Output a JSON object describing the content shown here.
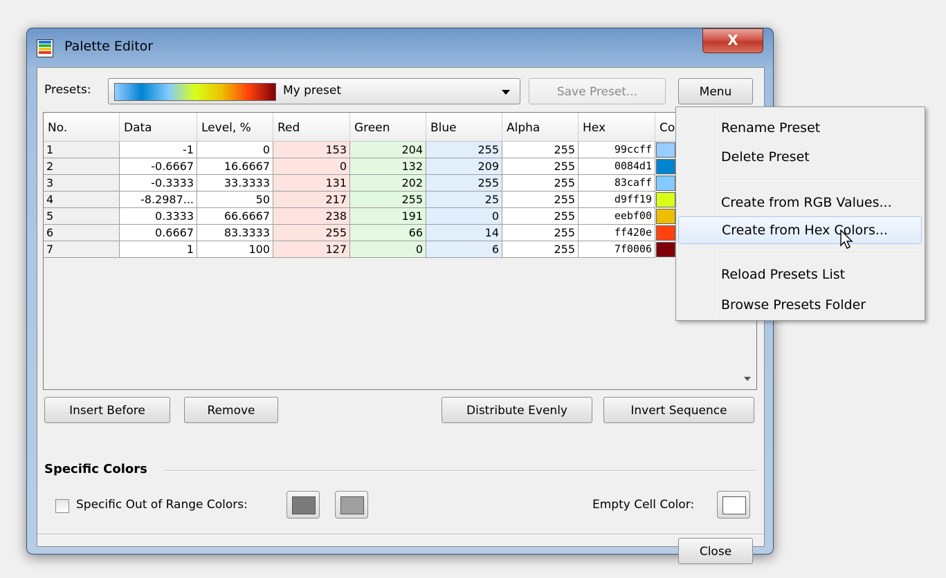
{
  "window": {
    "title": "Palette Editor",
    "close_glyph": "X"
  },
  "presets": {
    "label": "Presets:",
    "selected": "My preset",
    "save_label": "Save Preset...",
    "menu_label": "Menu"
  },
  "table": {
    "columns": [
      "No.",
      "Data",
      "Level, %",
      "Red",
      "Green",
      "Blue",
      "Alpha",
      "Hex",
      "Co"
    ],
    "rows": [
      {
        "no": "1",
        "data": "-1",
        "level": "0",
        "red": "153",
        "green": "204",
        "blue": "255",
        "alpha": "255",
        "hex": "99ccff",
        "color": "#99ccff"
      },
      {
        "no": "2",
        "data": "-0.6667",
        "level": "16.6667",
        "red": "0",
        "green": "132",
        "blue": "209",
        "alpha": "255",
        "hex": "0084d1",
        "color": "#0084d1"
      },
      {
        "no": "3",
        "data": "-0.3333",
        "level": "33.3333",
        "red": "131",
        "green": "202",
        "blue": "255",
        "alpha": "255",
        "hex": "83caff",
        "color": "#83caff"
      },
      {
        "no": "4",
        "data": "-8.2987...",
        "level": "50",
        "red": "217",
        "green": "255",
        "blue": "25",
        "alpha": "255",
        "hex": "d9ff19",
        "color": "#d9ff19"
      },
      {
        "no": "5",
        "data": "0.3333",
        "level": "66.6667",
        "red": "238",
        "green": "191",
        "blue": "0",
        "alpha": "255",
        "hex": "eebf00",
        "color": "#eebf00"
      },
      {
        "no": "6",
        "data": "0.6667",
        "level": "83.3333",
        "red": "255",
        "green": "66",
        "blue": "14",
        "alpha": "255",
        "hex": "ff420e",
        "color": "#ff420e"
      },
      {
        "no": "7",
        "data": "1",
        "level": "100",
        "red": "127",
        "green": "0",
        "blue": "6",
        "alpha": "255",
        "hex": "7f0006",
        "color": "#7f0006"
      }
    ]
  },
  "actions": {
    "insert_before": "Insert Before",
    "remove": "Remove",
    "distribute": "Distribute Evenly",
    "invert": "Invert Sequence"
  },
  "specific": {
    "section_title": "Specific Colors",
    "out_of_range_label": "Specific Out of Range Colors:",
    "out_of_range_checked": false,
    "low_color": "#7b7b7b",
    "high_color": "#a0a0a0",
    "empty_cell_label": "Empty Cell Color:",
    "empty_cell_color": "#ffffff"
  },
  "footer": {
    "close_label": "Close"
  },
  "menu": {
    "items": [
      "Rename Preset",
      "Delete Preset",
      "Create from RGB Values...",
      "Create from Hex Colors...",
      "Reload Presets List",
      "Browse Presets Folder"
    ],
    "highlighted": "Create from Hex Colors..."
  }
}
